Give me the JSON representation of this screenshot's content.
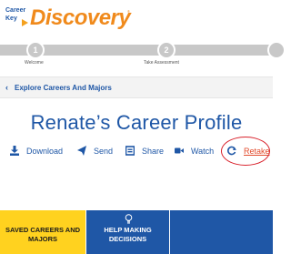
{
  "logo": {
    "line1": "Career",
    "line2": "Key",
    "brand": "Discovery",
    "tm": "®"
  },
  "stepper": {
    "steps": [
      {
        "number": "1",
        "label": "Welcome"
      },
      {
        "number": "2",
        "label": "Take Assessment"
      }
    ]
  },
  "breadcrumb": {
    "chevron": "‹",
    "label": "Explore Careers And Majors"
  },
  "page_title": "Renate’s Career Profile",
  "actions": [
    {
      "label": "Download",
      "icon": "download-icon"
    },
    {
      "label": "Send",
      "icon": "send-icon"
    },
    {
      "label": "Share",
      "icon": "share-icon"
    },
    {
      "label": "Watch",
      "icon": "video-icon"
    },
    {
      "label": "Retake",
      "icon": "refresh-icon"
    }
  ],
  "tiles": {
    "saved_line1": "SAVED CAREERS AND",
    "saved_line2": "MAJORS",
    "help_line1": "HELP MAKING",
    "help_line2": "DECISIONS"
  },
  "colors": {
    "brand_blue": "#1f57a6",
    "brand_orange": "#f08a1c",
    "tile_yellow": "#ffd21f",
    "retake_red": "#e24a2b",
    "annotation_red": "#d9232d"
  }
}
